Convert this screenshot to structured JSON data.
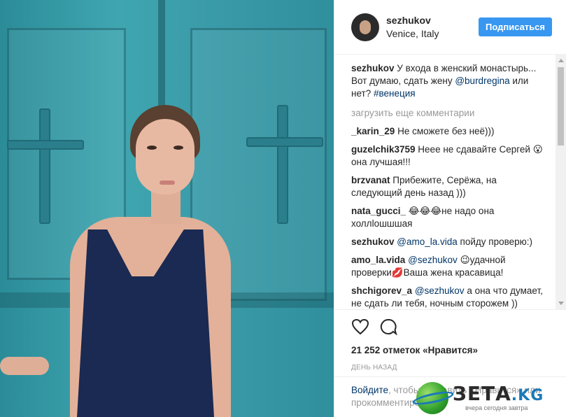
{
  "header": {
    "username": "sezhukov",
    "location": "Venice, Italy",
    "follow_label": "Подписаться"
  },
  "caption": {
    "user": "sezhukov",
    "text_1": " У входа в женский монастырь... Вот думаю, сдать жену ",
    "mention": "@burdregina",
    "text_2": " или нет? ",
    "hashtag": "#венеция"
  },
  "load_more": "загрузить еще комментарии",
  "comments": [
    {
      "user": "_karin_29",
      "text": " Не сможете без неё)))"
    },
    {
      "user": "guzelchik3759",
      "text": " Неее не сдавайте Сергей 😮 она лучшая!!!"
    },
    {
      "user": "brzvanat",
      "text": " Прибежите, Серёжа, на следующий день назад )))"
    },
    {
      "user": "nata_gucci_",
      "text": " 😂😂😂не надо она холлloшшшая"
    },
    {
      "user": "sezhukov",
      "mention": "@amo_la.vida",
      "text": " пойду проверю:)"
    },
    {
      "user": "amo_la.vida",
      "mention": "@sezhukov",
      "text": " 😉удачной проверки💋Ваша жена красавица!"
    },
    {
      "user": "shchigorev_a",
      "mention": "@sezhukov",
      "text": " а она что думает, не сдать ли тебя, ночным сторожем ))"
    }
  ],
  "likes": "21 252 отметок «Нравится»",
  "date": "ДЕНЬ НАЗАД",
  "login": {
    "link": "Войдите",
    "text": ", чтобы поставить «Нравится» или прокомментировать."
  },
  "icons": {
    "like": "heart-icon",
    "comment": "comment-icon"
  },
  "watermark": {
    "brand": "ЗЕТА",
    "tld": ".KG",
    "tagline": "вчера сегодня завтра"
  },
  "colors": {
    "accent": "#3897f0",
    "link": "#003569",
    "muted": "#999999"
  }
}
